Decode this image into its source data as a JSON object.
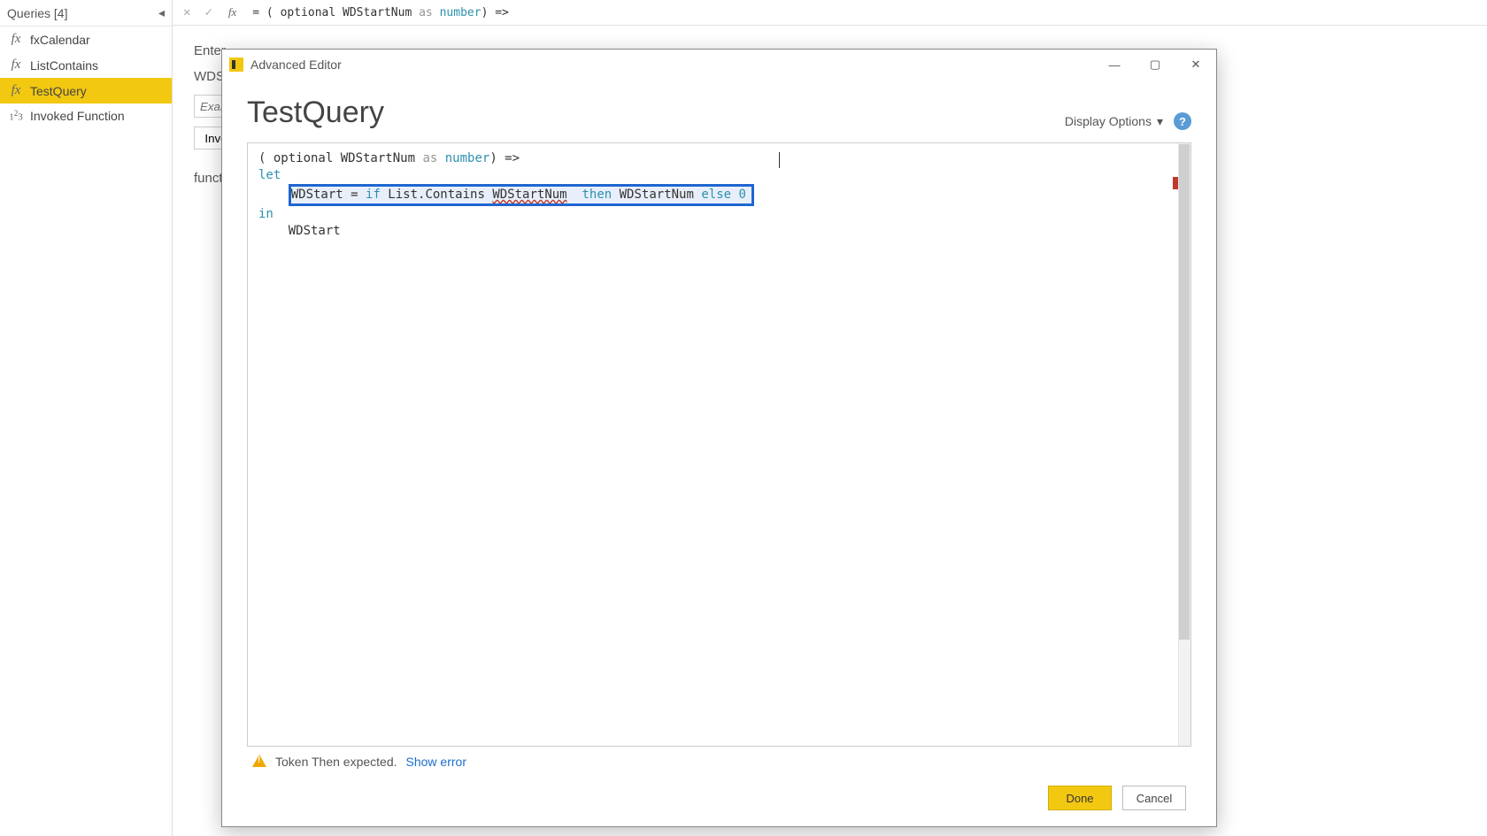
{
  "queries": {
    "header": "Queries [4]",
    "items": [
      {
        "icon": "fx",
        "label": "fxCalendar"
      },
      {
        "icon": "fx",
        "label": "ListContains"
      },
      {
        "icon": "fx",
        "label": "TestQuery",
        "selected": true
      },
      {
        "icon": "num",
        "label": "Invoked Function"
      }
    ]
  },
  "formula_bar": {
    "prefix": "= ( optional WDStartNum ",
    "as": "as",
    "num": "number",
    "suffix": ") =>"
  },
  "bg": {
    "enter_label": "Enter",
    "field_label": "WDSta",
    "placeholder": "Exam",
    "invoke": "Invo",
    "function_label": "functio"
  },
  "modal": {
    "window_title": "Advanced Editor",
    "title": "TestQuery",
    "display_options": "Display Options",
    "code": {
      "l1_a": "( optional WDStartNum ",
      "l1_as": "as",
      "l1_num": "number",
      "l1_b": ") =>",
      "l2": "let",
      "l3_a": "WDStart = ",
      "l3_if": "if",
      "l3_b": " List.Contains ",
      "l3_err": "WDStartNum",
      "l3_spc": "  ",
      "l3_then": "then",
      "l3_c": " WDStartNum ",
      "l3_else": "else",
      "l3_zero": " 0",
      "l4": "in",
      "l5": "    WDStart"
    },
    "error_text": "Token Then expected.",
    "show_error": "Show error",
    "done": "Done",
    "cancel": "Cancel"
  }
}
